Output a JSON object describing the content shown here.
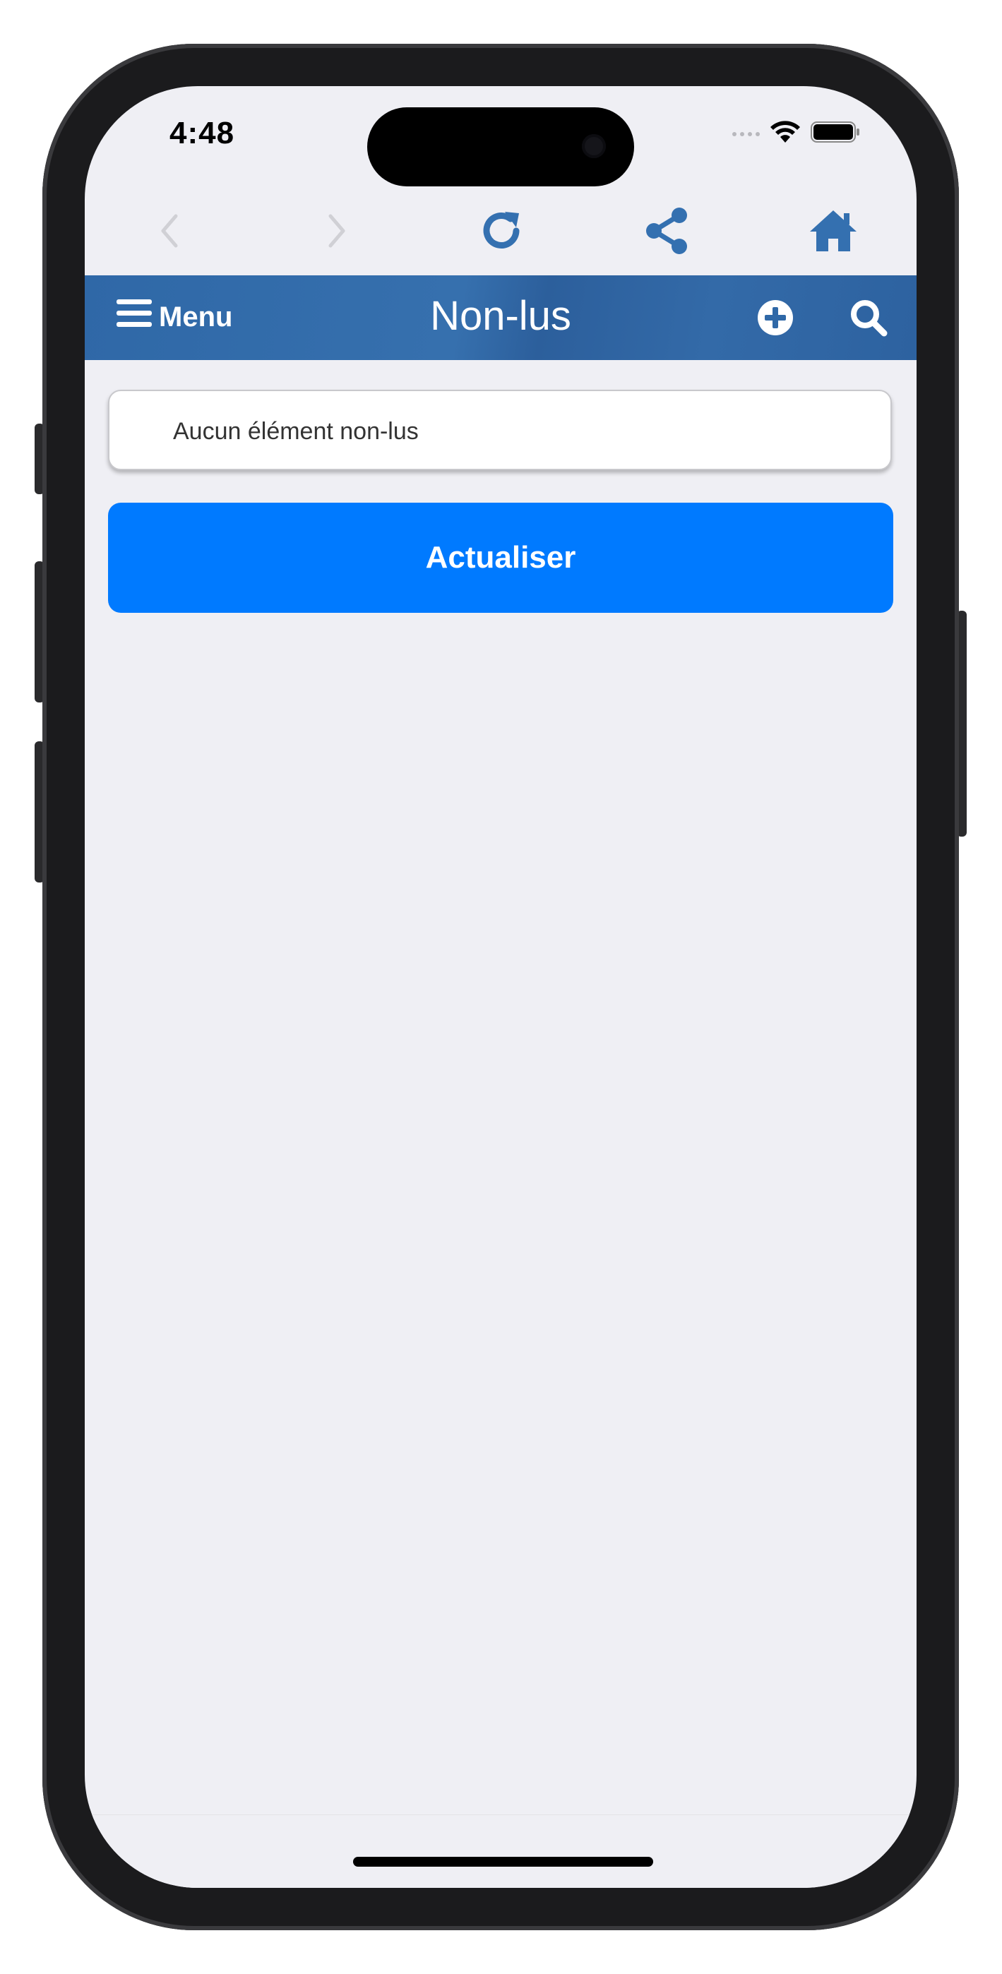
{
  "status_bar": {
    "time": "4:48"
  },
  "browser_toolbar": {
    "icons": [
      "back-chevron-icon",
      "forward-chevron-icon",
      "reload-icon",
      "share-icon",
      "home-icon"
    ],
    "accent_color": "#3470b0",
    "disabled_color": "#d0d0d5"
  },
  "header": {
    "menu_label": "Menu",
    "title": "Non-lus",
    "icons": [
      "plus-circle-icon",
      "search-icon"
    ]
  },
  "content": {
    "empty_message": "Aucun élément non-lus",
    "refresh_label": "Actualiser",
    "button_color": "#007aff"
  }
}
